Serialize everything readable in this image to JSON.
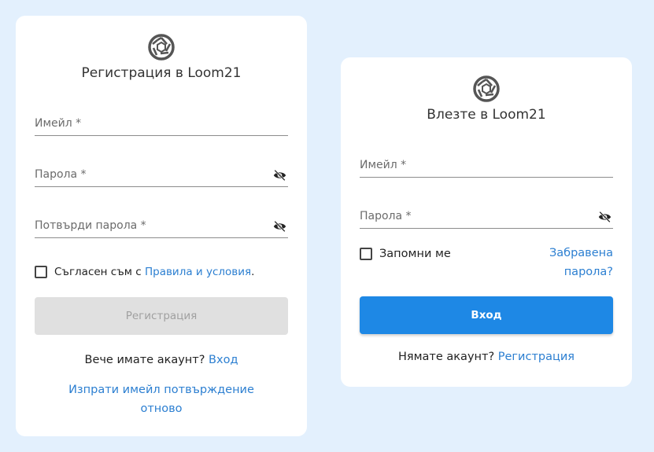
{
  "register": {
    "title": "Регистрация в Loom21",
    "email_placeholder": "Имейл *",
    "password_placeholder": "Парола *",
    "confirm_placeholder": "Потвърди парола *",
    "terms_prefix": "Съгласен съм с ",
    "terms_link": "Правила и условия",
    "terms_suffix": ".",
    "submit_label": "Регистрация",
    "have_account": "Вече имате акаунт?",
    "login_link": "Вход",
    "resend_line1": "Изпрати имейл потвърждение",
    "resend_line2": "отново"
  },
  "login": {
    "title": "Влезте в Loom21",
    "email_placeholder": "Имейл *",
    "password_placeholder": "Парола *",
    "remember_label": "Запомни ме",
    "forgot_line1": "Забравена",
    "forgot_line2": "парола?",
    "submit_label": "Вход",
    "no_account": "Нямате акаунт?",
    "register_link": "Регистрация"
  },
  "colors": {
    "background": "#e3f0fd",
    "primary": "#1e88e5",
    "link": "#2c7fd1",
    "disabled_bg": "#e0e0e0",
    "disabled_text": "#a0a0a0"
  },
  "icons": {
    "logo": "loom21-aperture-logo",
    "password_toggle": "eye-off-icon"
  }
}
